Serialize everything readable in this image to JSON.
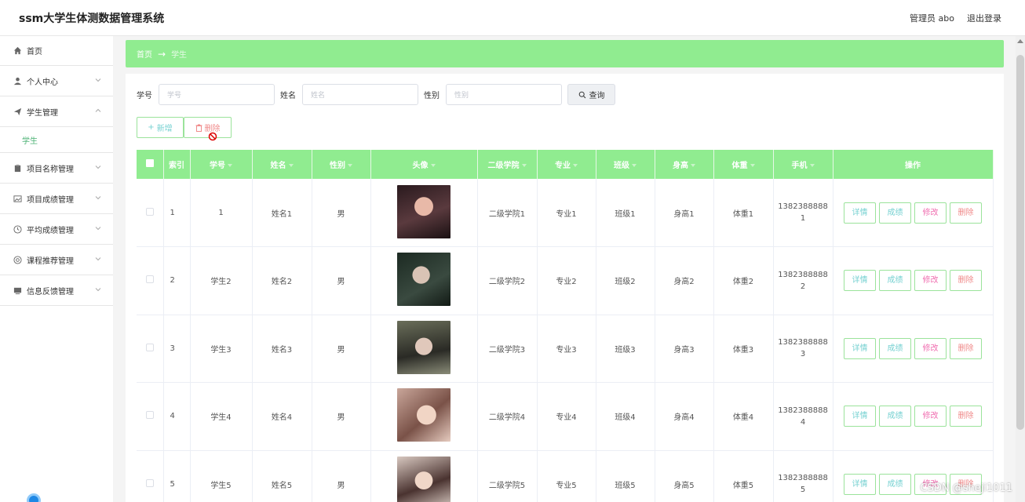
{
  "header": {
    "title": "ssm大学生体测数据管理系统",
    "admin_label": "管理员 abo",
    "logout_label": "退出登录"
  },
  "sidebar": {
    "items": [
      {
        "label": "首页",
        "icon": "home-icon",
        "expandable": false
      },
      {
        "label": "个人中心",
        "icon": "user-icon",
        "expandable": true
      },
      {
        "label": "学生管理",
        "icon": "paper-plane-icon",
        "expandable": true,
        "expanded": true,
        "sub": [
          {
            "label": "学生"
          }
        ]
      },
      {
        "label": "项目名称管理",
        "icon": "clipboard-icon",
        "expandable": true
      },
      {
        "label": "项目成绩管理",
        "icon": "picture-icon",
        "expandable": true
      },
      {
        "label": "平均成绩管理",
        "icon": "clock-icon",
        "expandable": true
      },
      {
        "label": "课程推荐管理",
        "icon": "target-icon",
        "expandable": true
      },
      {
        "label": "信息反馈管理",
        "icon": "monitor-icon",
        "expandable": true
      }
    ]
  },
  "breadcrumb": {
    "home": "首页",
    "separator": "→",
    "current": "学生"
  },
  "search": {
    "fields": [
      {
        "label": "学号",
        "placeholder": "学号"
      },
      {
        "label": "姓名",
        "placeholder": "姓名"
      },
      {
        "label": "性别",
        "placeholder": "性别"
      }
    ],
    "query_label": "查询"
  },
  "actions": {
    "add_label": "新增",
    "delete_label": "删除"
  },
  "table": {
    "columns": [
      "索引",
      "学号",
      "姓名",
      "性别",
      "头像",
      "二级学院",
      "专业",
      "班级",
      "身高",
      "体重",
      "手机",
      "操作"
    ],
    "op_labels": {
      "detail": "详情",
      "score": "成绩",
      "edit": "修改",
      "delete": "删除"
    },
    "rows": [
      {
        "index": "1",
        "xuehao": "1",
        "name": "姓名1",
        "gender": "男",
        "college": "二级学院1",
        "major": "专业1",
        "class": "班级1",
        "height": "身高1",
        "weight": "体重1",
        "phone_a": "1382388888",
        "phone_b": "1"
      },
      {
        "index": "2",
        "xuehao": "学生2",
        "name": "姓名2",
        "gender": "男",
        "college": "二级学院2",
        "major": "专业2",
        "class": "班级2",
        "height": "身高2",
        "weight": "体重2",
        "phone_a": "1382388888",
        "phone_b": "2"
      },
      {
        "index": "3",
        "xuehao": "学生3",
        "name": "姓名3",
        "gender": "男",
        "college": "二级学院3",
        "major": "专业3",
        "class": "班级3",
        "height": "身高3",
        "weight": "体重3",
        "phone_a": "1382388888",
        "phone_b": "3"
      },
      {
        "index": "4",
        "xuehao": "学生4",
        "name": "姓名4",
        "gender": "男",
        "college": "二级学院4",
        "major": "专业4",
        "class": "班级4",
        "height": "身高4",
        "weight": "体重4",
        "phone_a": "1382388888",
        "phone_b": "4"
      },
      {
        "index": "5",
        "xuehao": "学生5",
        "name": "姓名5",
        "gender": "男",
        "college": "二级学院5",
        "major": "专业5",
        "class": "班级5",
        "height": "身高5",
        "weight": "体重5",
        "phone_a": "1382388888",
        "phone_b": "5"
      }
    ]
  },
  "watermark": "CSDN @sheji1011",
  "colors": {
    "accent_green": "#90ec90",
    "teal_text": "#76d1d1",
    "pink_text": "#f06eb0",
    "red_text": "#f08a8a",
    "active_sub": "#4fb377"
  }
}
